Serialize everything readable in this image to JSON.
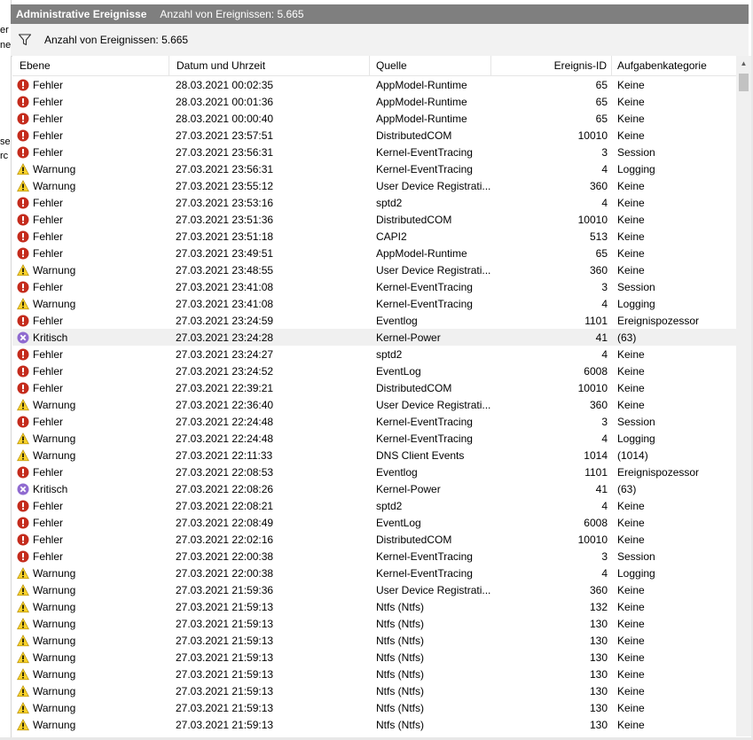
{
  "left_fragments": [
    "er",
    "ne",
    "se",
    "rc"
  ],
  "title": {
    "name": "Administrative Ereignisse",
    "count": "Anzahl von Ereignissen: 5.665"
  },
  "toolbar": {
    "count": "Anzahl von Ereignissen: 5.665",
    "filter_icon": "filter-icon"
  },
  "columns": [
    "Ebene",
    "Datum und Uhrzeit",
    "Quelle",
    "Ereignis-ID",
    "Aufgabenkategorie"
  ],
  "level_icons": {
    "Fehler": "error-icon",
    "Warnung": "warning-icon",
    "Kritisch": "critical-icon"
  },
  "colors": {
    "error": "#c42b1c",
    "warning": "#f8d22a",
    "critical": "#8f6ad0",
    "selected_row": "#f0f0f0",
    "titlebar": "#7f7f7f"
  },
  "rows": [
    {
      "level": "Fehler",
      "date": "28.03.2021 00:02:35",
      "source": "AppModel-Runtime",
      "id": "65",
      "category": "Keine"
    },
    {
      "level": "Fehler",
      "date": "28.03.2021 00:01:36",
      "source": "AppModel-Runtime",
      "id": "65",
      "category": "Keine"
    },
    {
      "level": "Fehler",
      "date": "28.03.2021 00:00:40",
      "source": "AppModel-Runtime",
      "id": "65",
      "category": "Keine"
    },
    {
      "level": "Fehler",
      "date": "27.03.2021 23:57:51",
      "source": "DistributedCOM",
      "id": "10010",
      "category": "Keine"
    },
    {
      "level": "Fehler",
      "date": "27.03.2021 23:56:31",
      "source": "Kernel-EventTracing",
      "id": "3",
      "category": "Session"
    },
    {
      "level": "Warnung",
      "date": "27.03.2021 23:56:31",
      "source": "Kernel-EventTracing",
      "id": "4",
      "category": "Logging"
    },
    {
      "level": "Warnung",
      "date": "27.03.2021 23:55:12",
      "source": "User Device Registrati...",
      "id": "360",
      "category": "Keine"
    },
    {
      "level": "Fehler",
      "date": "27.03.2021 23:53:16",
      "source": "sptd2",
      "id": "4",
      "category": "Keine"
    },
    {
      "level": "Fehler",
      "date": "27.03.2021 23:51:36",
      "source": "DistributedCOM",
      "id": "10010",
      "category": "Keine"
    },
    {
      "level": "Fehler",
      "date": "27.03.2021 23:51:18",
      "source": "CAPI2",
      "id": "513",
      "category": "Keine"
    },
    {
      "level": "Fehler",
      "date": "27.03.2021 23:49:51",
      "source": "AppModel-Runtime",
      "id": "65",
      "category": "Keine"
    },
    {
      "level": "Warnung",
      "date": "27.03.2021 23:48:55",
      "source": "User Device Registrati...",
      "id": "360",
      "category": "Keine"
    },
    {
      "level": "Fehler",
      "date": "27.03.2021 23:41:08",
      "source": "Kernel-EventTracing",
      "id": "3",
      "category": "Session"
    },
    {
      "level": "Warnung",
      "date": "27.03.2021 23:41:08",
      "source": "Kernel-EventTracing",
      "id": "4",
      "category": "Logging"
    },
    {
      "level": "Fehler",
      "date": "27.03.2021 23:24:59",
      "source": "Eventlog",
      "id": "1101",
      "category": "Ereignispozessor"
    },
    {
      "level": "Kritisch",
      "date": "27.03.2021 23:24:28",
      "source": "Kernel-Power",
      "id": "41",
      "category": "(63)",
      "selected": true
    },
    {
      "level": "Fehler",
      "date": "27.03.2021 23:24:27",
      "source": "sptd2",
      "id": "4",
      "category": "Keine"
    },
    {
      "level": "Fehler",
      "date": "27.03.2021 23:24:52",
      "source": "EventLog",
      "id": "6008",
      "category": "Keine"
    },
    {
      "level": "Fehler",
      "date": "27.03.2021 22:39:21",
      "source": "DistributedCOM",
      "id": "10010",
      "category": "Keine"
    },
    {
      "level": "Warnung",
      "date": "27.03.2021 22:36:40",
      "source": "User Device Registrati...",
      "id": "360",
      "category": "Keine"
    },
    {
      "level": "Fehler",
      "date": "27.03.2021 22:24:48",
      "source": "Kernel-EventTracing",
      "id": "3",
      "category": "Session"
    },
    {
      "level": "Warnung",
      "date": "27.03.2021 22:24:48",
      "source": "Kernel-EventTracing",
      "id": "4",
      "category": "Logging"
    },
    {
      "level": "Warnung",
      "date": "27.03.2021 22:11:33",
      "source": "DNS Client Events",
      "id": "1014",
      "category": "(1014)"
    },
    {
      "level": "Fehler",
      "date": "27.03.2021 22:08:53",
      "source": "Eventlog",
      "id": "1101",
      "category": "Ereignispozessor"
    },
    {
      "level": "Kritisch",
      "date": "27.03.2021 22:08:26",
      "source": "Kernel-Power",
      "id": "41",
      "category": "(63)"
    },
    {
      "level": "Fehler",
      "date": "27.03.2021 22:08:21",
      "source": "sptd2",
      "id": "4",
      "category": "Keine"
    },
    {
      "level": "Fehler",
      "date": "27.03.2021 22:08:49",
      "source": "EventLog",
      "id": "6008",
      "category": "Keine"
    },
    {
      "level": "Fehler",
      "date": "27.03.2021 22:02:16",
      "source": "DistributedCOM",
      "id": "10010",
      "category": "Keine"
    },
    {
      "level": "Fehler",
      "date": "27.03.2021 22:00:38",
      "source": "Kernel-EventTracing",
      "id": "3",
      "category": "Session"
    },
    {
      "level": "Warnung",
      "date": "27.03.2021 22:00:38",
      "source": "Kernel-EventTracing",
      "id": "4",
      "category": "Logging"
    },
    {
      "level": "Warnung",
      "date": "27.03.2021 21:59:36",
      "source": "User Device Registrati...",
      "id": "360",
      "category": "Keine"
    },
    {
      "level": "Warnung",
      "date": "27.03.2021 21:59:13",
      "source": "Ntfs (Ntfs)",
      "id": "132",
      "category": "Keine"
    },
    {
      "level": "Warnung",
      "date": "27.03.2021 21:59:13",
      "source": "Ntfs (Ntfs)",
      "id": "130",
      "category": "Keine"
    },
    {
      "level": "Warnung",
      "date": "27.03.2021 21:59:13",
      "source": "Ntfs (Ntfs)",
      "id": "130",
      "category": "Keine"
    },
    {
      "level": "Warnung",
      "date": "27.03.2021 21:59:13",
      "source": "Ntfs (Ntfs)",
      "id": "130",
      "category": "Keine"
    },
    {
      "level": "Warnung",
      "date": "27.03.2021 21:59:13",
      "source": "Ntfs (Ntfs)",
      "id": "130",
      "category": "Keine"
    },
    {
      "level": "Warnung",
      "date": "27.03.2021 21:59:13",
      "source": "Ntfs (Ntfs)",
      "id": "130",
      "category": "Keine"
    },
    {
      "level": "Warnung",
      "date": "27.03.2021 21:59:13",
      "source": "Ntfs (Ntfs)",
      "id": "130",
      "category": "Keine"
    },
    {
      "level": "Warnung",
      "date": "27.03.2021 21:59:13",
      "source": "Ntfs (Ntfs)",
      "id": "130",
      "category": "Keine"
    }
  ]
}
